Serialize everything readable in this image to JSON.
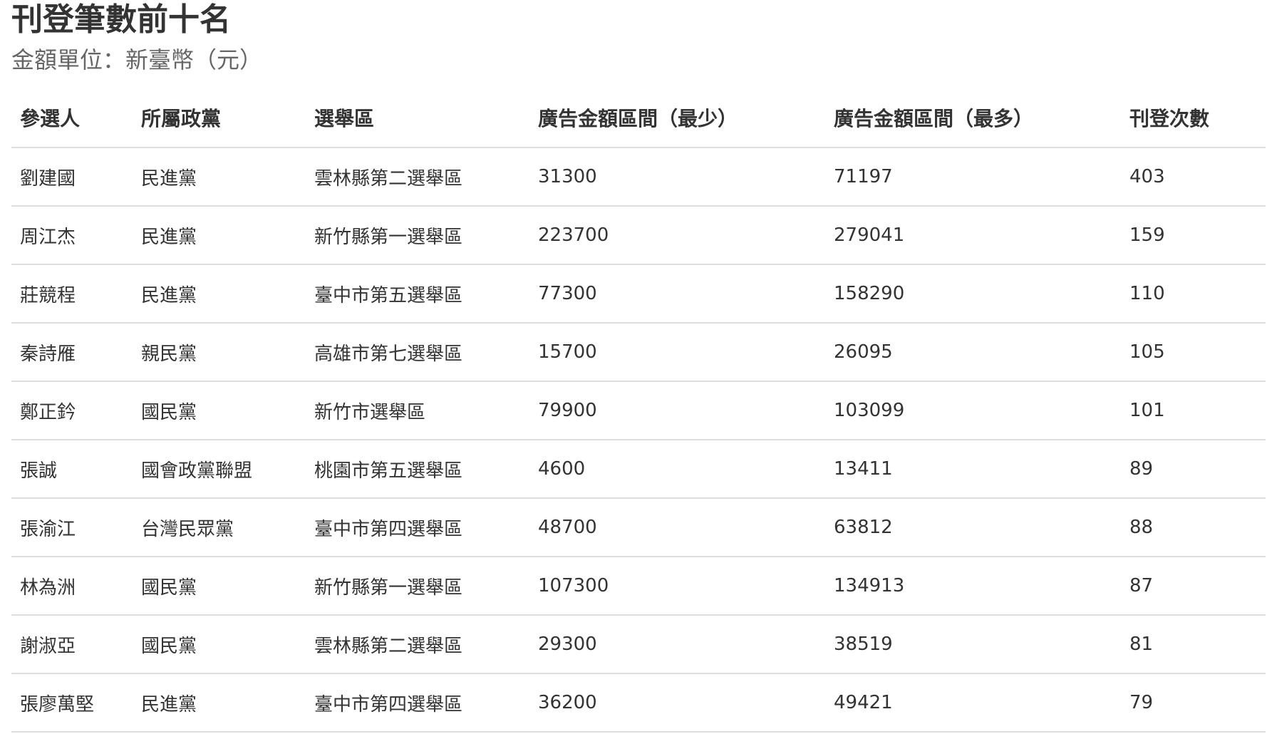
{
  "title": "刊登筆數前十名",
  "subtitle": "金額單位：新臺幣（元）",
  "table": {
    "headers": [
      "參選人",
      "所屬政黨",
      "選舉區",
      "廣告金額區間（最少）",
      "廣告金額區間（最多）",
      "刊登次數"
    ],
    "rows": [
      [
        "劉建國",
        "民進黨",
        "雲林縣第二選舉區",
        "31300",
        "71197",
        "403"
      ],
      [
        "周江杰",
        "民進黨",
        "新竹縣第一選舉區",
        "223700",
        "279041",
        "159"
      ],
      [
        "莊競程",
        "民進黨",
        "臺中市第五選舉區",
        "77300",
        "158290",
        "110"
      ],
      [
        "秦詩雁",
        "親民黨",
        "高雄市第七選舉區",
        "15700",
        "26095",
        "105"
      ],
      [
        "鄭正鈐",
        "國民黨",
        "新竹市選舉區",
        "79900",
        "103099",
        "101"
      ],
      [
        "張誠",
        "國會政黨聯盟",
        "桃園市第五選舉區",
        "4600",
        "13411",
        "89"
      ],
      [
        "張渝江",
        "台灣民眾黨",
        "臺中市第四選舉區",
        "48700",
        "63812",
        "88"
      ],
      [
        "林為洲",
        "國民黨",
        "新竹縣第一選舉區",
        "107300",
        "134913",
        "87"
      ],
      [
        "謝淑亞",
        "國民黨",
        "雲林縣第二選舉區",
        "29300",
        "38519",
        "81"
      ],
      [
        "張廖萬堅",
        "民進黨",
        "臺中市第四選舉區",
        "36200",
        "49421",
        "79"
      ]
    ]
  }
}
